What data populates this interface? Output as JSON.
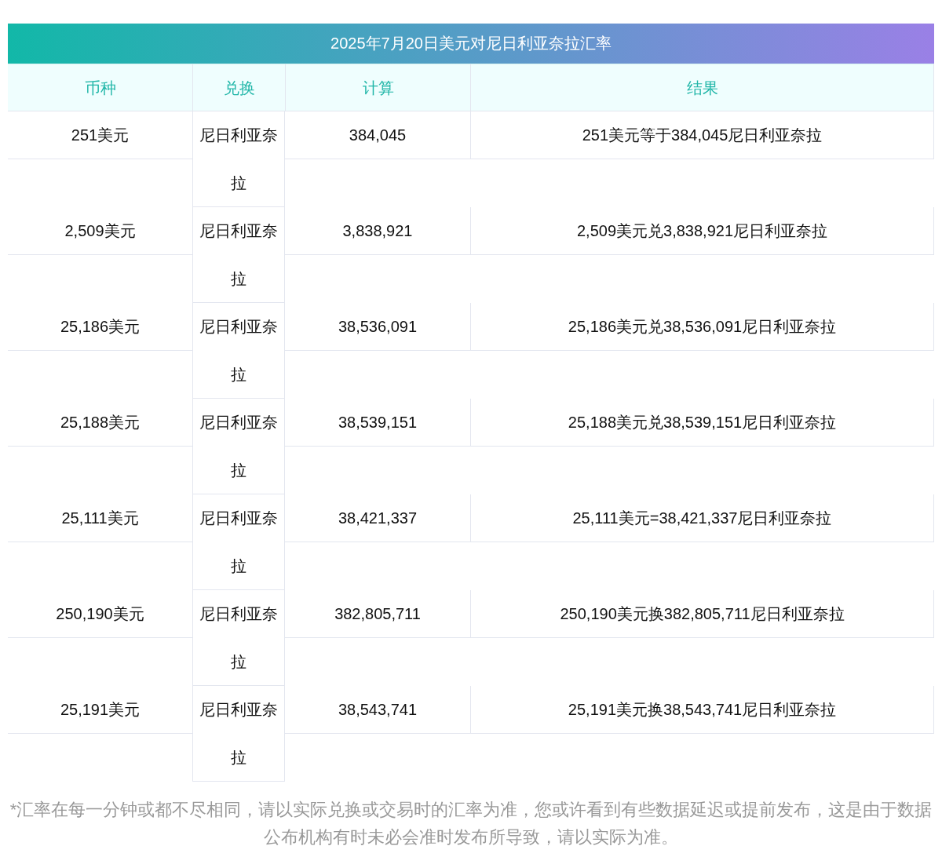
{
  "table": {
    "title": "2025年7月20日美元对尼日利亚奈拉汇率",
    "columns": [
      "币种",
      "兑换",
      "计算",
      "结果"
    ],
    "rows": [
      {
        "currency": "251美元",
        "exchange": "尼日利亚奈拉",
        "amount": "384,045",
        "result": "251美元等于384,045尼日利亚奈拉"
      },
      {
        "currency": "2,509美元",
        "exchange": "尼日利亚奈拉",
        "amount": "3,838,921",
        "result": "2,509美元兑3,838,921尼日利亚奈拉"
      },
      {
        "currency": "25,186美元",
        "exchange": "尼日利亚奈拉",
        "amount": "38,536,091",
        "result": "25,186美元兑38,536,091尼日利亚奈拉"
      },
      {
        "currency": "25,188美元",
        "exchange": "尼日利亚奈拉",
        "amount": "38,539,151",
        "result": "25,188美元兑38,539,151尼日利亚奈拉"
      },
      {
        "currency": "25,111美元",
        "exchange": "尼日利亚奈拉",
        "amount": "38,421,337",
        "result": "25,111美元=38,421,337尼日利亚奈拉"
      },
      {
        "currency": "250,190美元",
        "exchange": "尼日利亚奈拉",
        "amount": "382,805,711",
        "result": "250,190美元换382,805,711尼日利亚奈拉"
      },
      {
        "currency": "25,191美元",
        "exchange": "尼日利亚奈拉",
        "amount": "38,543,741",
        "result": "25,191美元换38,543,741尼日利亚奈拉"
      }
    ]
  },
  "footnote": "*汇率在每一分钟或都不尽相同，请以实际兑换或交易时的汇率为准，您或许看到有些数据延迟或提前发布，这是由于数据公布机构有时未必会准时发布所导致，请以实际为准。"
}
